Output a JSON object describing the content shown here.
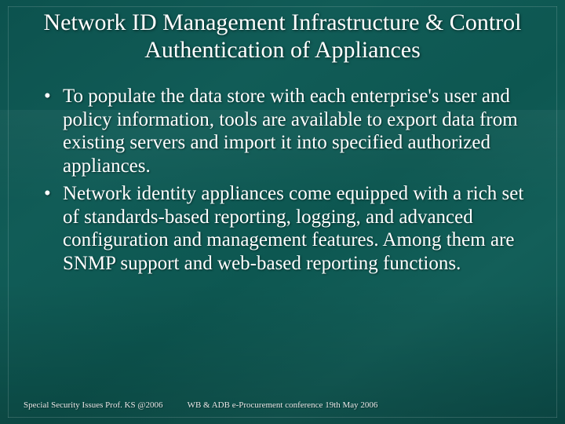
{
  "title": "Network ID Management Infrastructure & Control Authentication of Appliances",
  "bullets": [
    "To populate the data store with each enterprise's user and policy information, tools are available to export data from existing servers and import it into specified authorized  appliances.",
    " Network identity appliances come equipped with a rich set of standards-based reporting, logging, and advanced configuration and management features. Among them are SNMP support and web-based reporting functions."
  ],
  "footer": {
    "left": "Special Security Issues  Prof. KS @2006",
    "center": "WB & ADB e-Procurement  conference  19th May 2006"
  }
}
